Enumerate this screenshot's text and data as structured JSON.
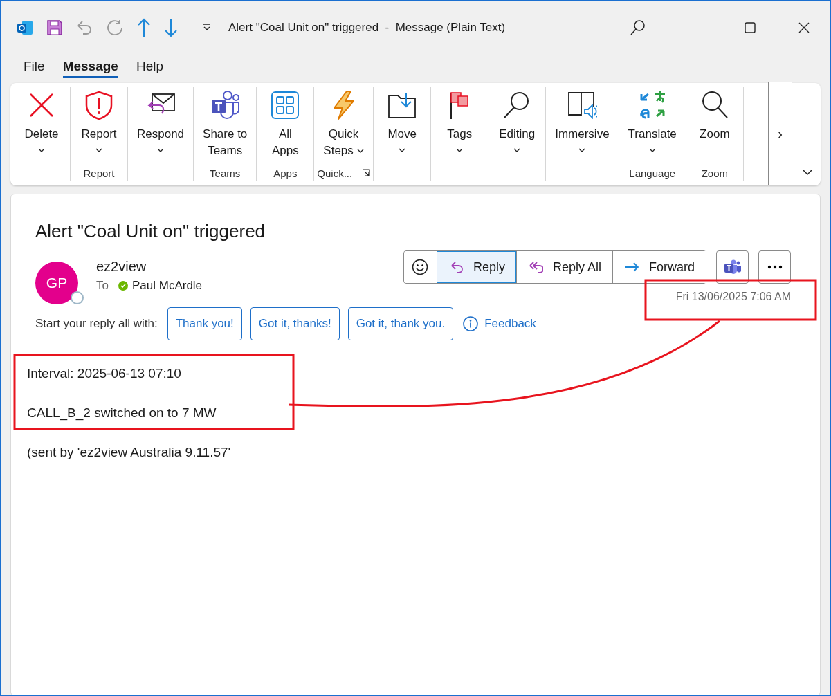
{
  "window": {
    "title": "Alert \"Coal Unit on\" triggered  -  Message (Plain Text)"
  },
  "menu_tabs": [
    {
      "label": "File",
      "selected": false
    },
    {
      "label": "Message",
      "selected": true
    },
    {
      "label": "Help",
      "selected": false
    }
  ],
  "ribbon": {
    "groups": [
      {
        "buttons": [
          {
            "lines": [
              "Delete"
            ],
            "dropdown": true
          }
        ]
      },
      {
        "label": "Report",
        "buttons": [
          {
            "lines": [
              "Report"
            ],
            "dropdown": true
          }
        ]
      },
      {
        "buttons": [
          {
            "lines": [
              "Respond"
            ],
            "dropdown": true
          }
        ]
      },
      {
        "label": "Teams",
        "buttons": [
          {
            "lines": [
              "Share to",
              "Teams"
            ],
            "dropdown": false
          }
        ]
      },
      {
        "label": "Apps",
        "buttons": [
          {
            "lines": [
              "All",
              "Apps"
            ],
            "dropdown": false
          }
        ]
      },
      {
        "label": "Quick...",
        "launcher": true,
        "buttons": [
          {
            "lines": [
              "Quick",
              "Steps"
            ],
            "dropdown": true
          }
        ]
      },
      {
        "buttons": [
          {
            "lines": [
              "Move"
            ],
            "dropdown": true
          }
        ]
      },
      {
        "buttons": [
          {
            "lines": [
              "Tags"
            ],
            "dropdown": true
          }
        ]
      },
      {
        "buttons": [
          {
            "lines": [
              "Editing"
            ],
            "dropdown": true
          }
        ]
      },
      {
        "buttons": [
          {
            "lines": [
              "Immersive"
            ],
            "dropdown": true
          }
        ]
      },
      {
        "label": "Language",
        "buttons": [
          {
            "lines": [
              "Translate"
            ],
            "dropdown": true
          }
        ]
      },
      {
        "label": "Zoom",
        "buttons": [
          {
            "lines": [
              "Zoom"
            ],
            "dropdown": false
          }
        ]
      }
    ],
    "more": "›"
  },
  "message": {
    "subject": "Alert \"Coal Unit on\" triggered",
    "avatar_initials": "GP",
    "sender": "ez2view",
    "to_label": "To",
    "recipient": "Paul McArdle",
    "actions": [
      {
        "label": "Reply",
        "selected": true
      },
      {
        "label": "Reply All",
        "selected": false
      },
      {
        "label": "Forward",
        "selected": false
      }
    ],
    "date": "Fri 13/06/2025 7:06 AM",
    "quick_reply": {
      "prompt": "Start your reply all with:",
      "suggestions": [
        "Thank you!",
        "Got it, thanks!",
        "Got it, thank you."
      ],
      "feedback": "Feedback"
    },
    "body": [
      "Interval: 2025-06-13 07:10",
      "CALL_B_2 switched on to 7 MW",
      "(sent by 'ez2view Australia 9.11.57'"
    ]
  }
}
